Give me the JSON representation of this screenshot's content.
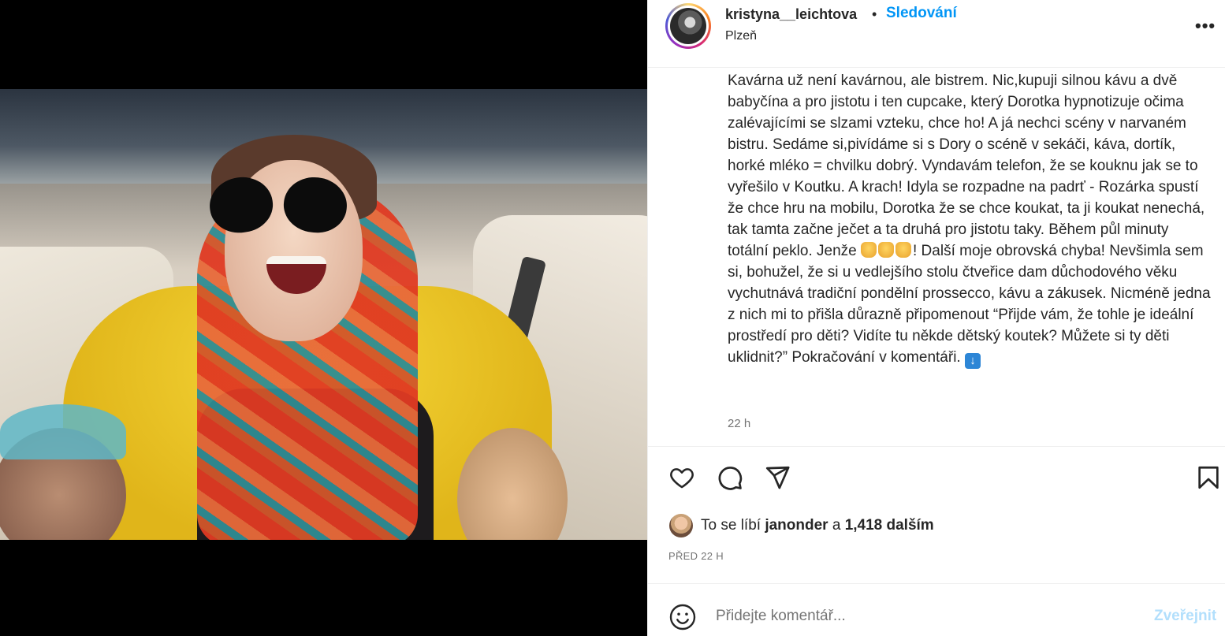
{
  "post": {
    "username": "kristyna__leichtova",
    "separator": "•",
    "follow_label": "Sledování",
    "location": "Plzeň",
    "more_label": "•••"
  },
  "caption": {
    "text_part1": "Kavárna už není kavárnou, ale bistrem. Nic,kupuji silnou kávu a dvě babyčína a pro jistotu i ten cupcake, který Dorotka hypnotizuje očima zalévajícími se slzami vzteku, chce ho! A já nechci scény v narvaném bistru. Sedáme si,pivídáme si s Dory o scéně v sekáči, káva, dortík, horké mléko = chvilku dobrý. Vyndavám telefon, že se kouknu jak se to vyřešilo v Koutku. A krach! Idyla se rozpadne na padrť - Rozárka spustí že chce hru na mobilu, Dorotka že se chce koukat, ta ji koukat nenechá, tak tamta začne ječet a ta druhá pro jistotu taky. Během půl minuty totální peklo. Jenže ",
    "text_part2": "! Další moje obrovská chyba! Nevšimla sem si, bohužel, že si u vedlejšího stolu čtveřice dam důchodového věku vychutnává tradiční pondělní prossecco, kávu a zákusek. Nicméně jedna z nich mi to přišla důrazně připomenout “Přijde vám, že tohle je ideální prostředí pro děti? Vidíte tu někde dětský koutek? Můžete si ty děti uklidnit?” Pokračování v komentáři. ",
    "emoji_hands": [
      "pointing-down-hand",
      "pointing-down-hand",
      "pointing-down-hand"
    ],
    "emoji_arrow": "↓",
    "time": "22 h"
  },
  "actions": {
    "like_icon": "heart-icon",
    "comment_icon": "comment-icon",
    "share_icon": "share-icon",
    "save_icon": "bookmark-icon"
  },
  "likes": {
    "prefix": "To se líbí ",
    "user": "janonder",
    "middle": " a ",
    "count": "1,418 dalším"
  },
  "posted": "PŘED 22 H",
  "comment": {
    "placeholder": "Přidejte komentář...",
    "post_label": "Zveřejnit"
  },
  "colors": {
    "accent": "#0095f6",
    "muted": "#737373",
    "post_disabled": "#b2dffc"
  }
}
